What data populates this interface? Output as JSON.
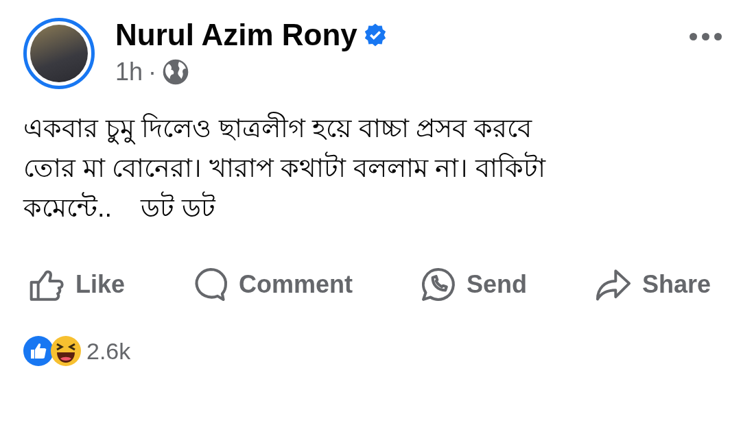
{
  "author": {
    "name": "Nurul Azim Rony",
    "verified": true,
    "time": "1h",
    "separator": "·"
  },
  "post": {
    "text": "একবার চুমু দিলেও ছাত্রলীগ হয়ে বাচ্চা প্রসব করবে\nতোর মা বোনেরা। খারাপ কথাটা বললাম না। বাকিটা\nকমেন্টে..    ডট ডট"
  },
  "actions": [
    {
      "kind": "like",
      "label": "Like"
    },
    {
      "kind": "comment",
      "label": "Comment"
    },
    {
      "kind": "send",
      "label": "Send"
    },
    {
      "kind": "share",
      "label": "Share"
    }
  ],
  "reactions": {
    "count": "2.6k"
  }
}
